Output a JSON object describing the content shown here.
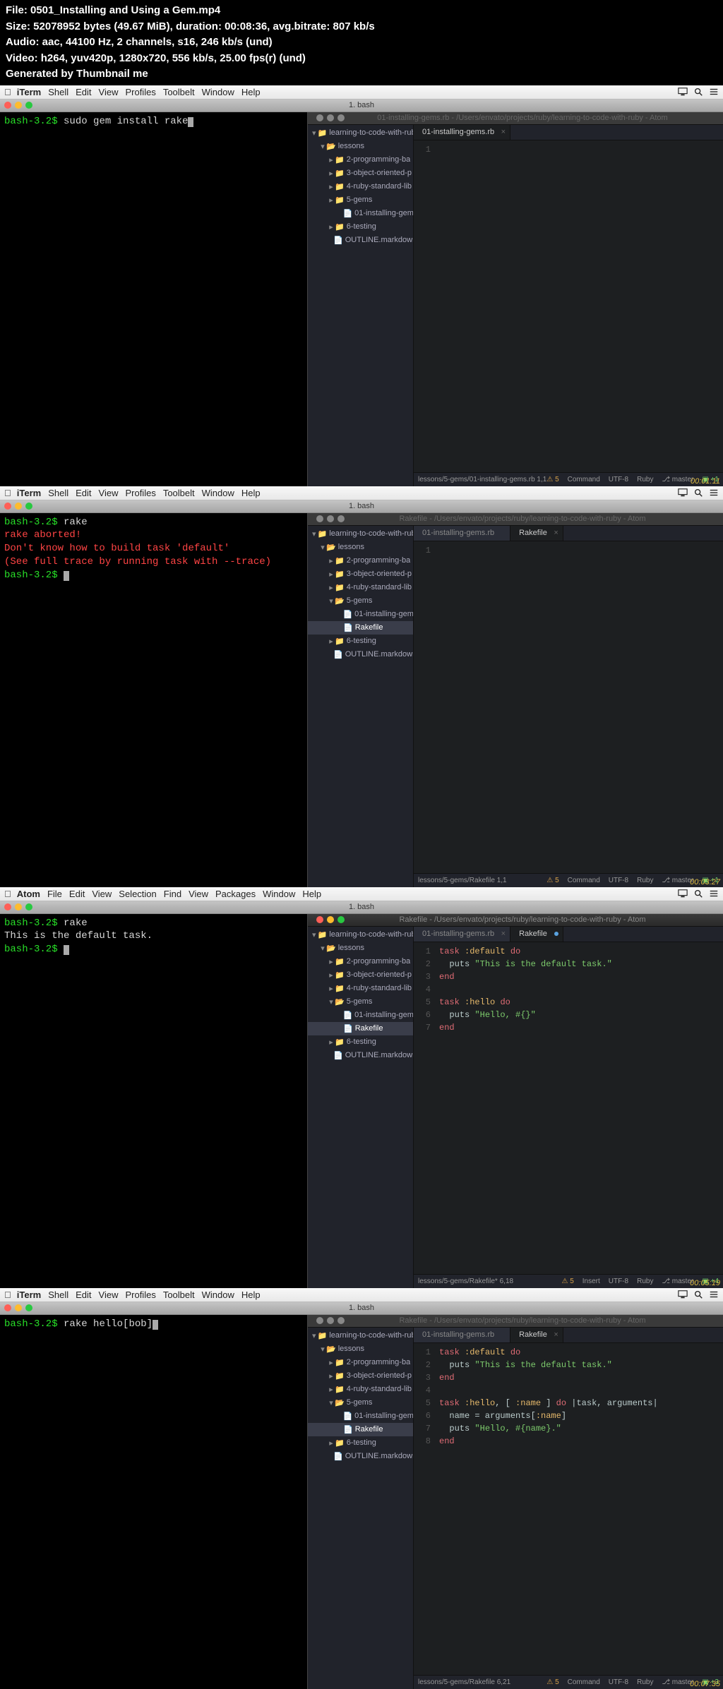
{
  "header": {
    "file": "File: 0501_Installing and Using a Gem.mp4",
    "size": "Size: 52078952 bytes (49.67 MiB), duration: 00:08:36, avg.bitrate: 807 kb/s",
    "audio": "Audio: aac, 44100 Hz, 2 channels, s16, 246 kb/s (und)",
    "video": "Video: h264, yuv420p, 1280x720, 556 kb/s, 25.00 fps(r) (und)",
    "gen": "Generated by Thumbnail me"
  },
  "mac_menu": {
    "iterm": {
      "app": "iTerm",
      "items": [
        "Shell",
        "Edit",
        "View",
        "Profiles",
        "Toolbelt",
        "Window",
        "Help"
      ]
    },
    "atom": {
      "app": "Atom",
      "items": [
        "File",
        "Edit",
        "View",
        "Selection",
        "Find",
        "View",
        "Packages",
        "Window",
        "Help"
      ]
    }
  },
  "term_tab": "1. bash",
  "panes": [
    {
      "timestamp": "00:01:11",
      "menubar": "iterm",
      "term": [
        "<p>bash-3.2$</p> <c>sudo gem install rake</c><cur>"
      ],
      "atom": {
        "title": "01-installing-gems.rb - /Users/envato/projects/ruby/learning-to-code-with-ruby - Atom",
        "active": false,
        "tree_open": false,
        "tree_sel": null,
        "tabs": [
          {
            "label": "01-installing-gems.rb",
            "active": true,
            "mod": false,
            "close": true
          }
        ],
        "code": [],
        "gutter": [
          "1"
        ],
        "status": {
          "path": "lessons/5-gems/01-installing-gems.rb",
          "pos": "1,1",
          "warn": 5,
          "mode": "Command",
          "enc": "UTF-8",
          "lang": "Ruby",
          "branch": "master",
          "plus": "+1"
        }
      }
    },
    {
      "timestamp": "00:03:27",
      "menubar": "iterm",
      "term": [
        "<p>bash-3.2$</p> <c>rake</c>",
        "<e>rake aborted!</e>",
        "<e>Don't know how to build task 'default'</e>",
        "",
        "<e>(See full trace by running task with --trace)</e>",
        "<p>bash-3.2$</p> <cur>"
      ],
      "atom": {
        "title": "Rakefile - /Users/envato/projects/ruby/learning-to-code-with-ruby - Atom",
        "active": false,
        "tree_open": true,
        "tree_sel": "Rakefile",
        "tabs": [
          {
            "label": "01-installing-gems.rb",
            "active": false
          },
          {
            "label": "Rakefile",
            "active": true,
            "mod": false,
            "close": true
          }
        ],
        "code": [],
        "gutter": [
          "1"
        ],
        "status": {
          "path": "lessons/5-gems/Rakefile",
          "pos": "1,1",
          "warn": 5,
          "mode": "Command",
          "enc": "UTF-8",
          "lang": "Ruby",
          "branch": "master",
          "plus": "+1"
        }
      }
    },
    {
      "timestamp": "00:05:19",
      "menubar": "atom",
      "term": [
        "<p>bash-3.2$</p> <c>rake</c>",
        "<c>This is the default task.</c>",
        "<p>bash-3.2$</p> <cur>"
      ],
      "atom": {
        "title": "Rakefile - /Users/envato/projects/ruby/learning-to-code-with-ruby - Atom",
        "active": true,
        "tree_open": true,
        "tree_sel": "Rakefile",
        "tabs": [
          {
            "label": "01-installing-gems.rb",
            "active": false,
            "close": true
          },
          {
            "label": "Rakefile",
            "active": true,
            "mod": true
          }
        ],
        "code": [
          "<k>task</k> <s>:default</s> <k>do</k>",
          "  puts <q>\"This is the default task.\"</q>",
          "<k>end</k>",
          "",
          "<k>task</k> <s>:hello</s> <k>do</k>",
          "  puts <q>\"Hello, #{}\"</q>",
          "<k>end</k>"
        ],
        "gutter": [
          "1",
          "2",
          "3",
          "4",
          "5",
          "6",
          "7"
        ],
        "status": {
          "path": "lessons/5-gems/Rakefile*",
          "pos": "6,18",
          "warn": 5,
          "mode": "Insert",
          "enc": "UTF-8",
          "lang": "Ruby",
          "branch": "master",
          "plus": "+4"
        }
      }
    },
    {
      "timestamp": "00:07:35",
      "menubar": "iterm",
      "term": [
        "<p>bash-3.2$</p> <c>rake hello[bob]</c><cur>"
      ],
      "atom": {
        "title": "Rakefile - /Users/envato/projects/ruby/learning-to-code-with-ruby - Atom",
        "active": false,
        "tree_open": true,
        "tree_sel": "Rakefile",
        "tabs": [
          {
            "label": "01-installing-gems.rb",
            "active": false
          },
          {
            "label": "Rakefile",
            "active": true,
            "mod": false,
            "close": true
          }
        ],
        "code": [
          "<k>task</k> <s>:default</s> <k>do</k>",
          "  puts <q>\"This is the default task.\"</q>",
          "<k>end</k>",
          "",
          "<k>task</k> <s>:hello</s>, [ <s>:name</s> ] <k>do</k> |task, arguments|",
          "  name = arguments[<s>:name</s>]",
          "  puts <q>\"Hello, #{name}.\"</q>",
          "<k>end</k>"
        ],
        "gutter": [
          "1",
          "2",
          "3",
          "4",
          "5",
          "6",
          "7",
          "8"
        ],
        "status": {
          "path": "lessons/5-gems/Rakefile",
          "pos": "6,21",
          "warn": 5,
          "mode": "Command",
          "enc": "UTF-8",
          "lang": "Ruby",
          "branch": "master",
          "plus": "+3"
        }
      }
    }
  ],
  "tree": {
    "root": "learning-to-code-with-rub",
    "folders": [
      {
        "name": "lessons",
        "depth": 1,
        "open": true
      },
      {
        "name": "2-programming-ba",
        "depth": 2
      },
      {
        "name": "3-object-oriented-p",
        "depth": 2
      },
      {
        "name": "4-ruby-standard-lib",
        "depth": 2
      },
      {
        "name": "5-gems",
        "depth": 2,
        "openable": true
      },
      {
        "name": "6-testing",
        "depth": 2
      }
    ],
    "file_in_gems": "01-installing-gem",
    "rakefile": "Rakefile",
    "outline": "OUTLINE.markdown"
  }
}
